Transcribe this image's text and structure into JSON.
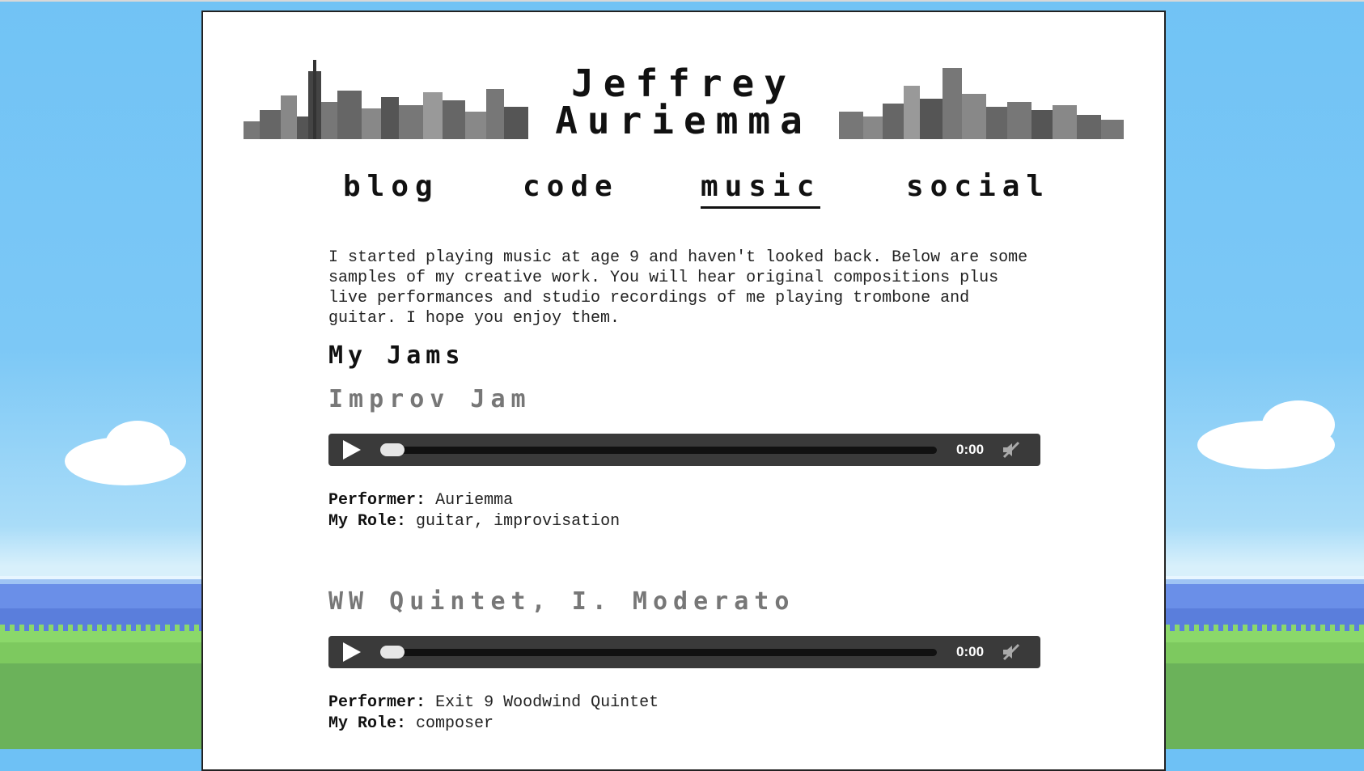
{
  "header": {
    "title_line1": "Jeffrey",
    "title_line2": "Auriemma"
  },
  "nav": {
    "items": [
      {
        "label": "blog"
      },
      {
        "label": "code"
      },
      {
        "label": "music"
      },
      {
        "label": "social"
      }
    ],
    "active": "music"
  },
  "main": {
    "intro": "I started playing music at age 9 and haven't looked back. Below are some samples of my creative work. You will hear original compositions plus live performances and studio recordings of me playing trombone and guitar. I hope you enjoy them.",
    "section_title": "My Jams",
    "tracks": [
      {
        "title": "Improv Jam",
        "time": "0:00",
        "performer_label": "Performer",
        "performer": "Auriemma",
        "role_label": "My Role",
        "role": "guitar, improvisation"
      },
      {
        "title": "WW Quintet, I. Moderato",
        "time": "0:00",
        "performer_label": "Performer",
        "performer": "Exit 9 Woodwind Quintet",
        "role_label": "My Role",
        "role": "composer"
      }
    ]
  },
  "colors": {
    "sky": "#71c3f5",
    "panel": "#ffffff",
    "player": "#3a3a3a",
    "subtitle": "#777777"
  }
}
